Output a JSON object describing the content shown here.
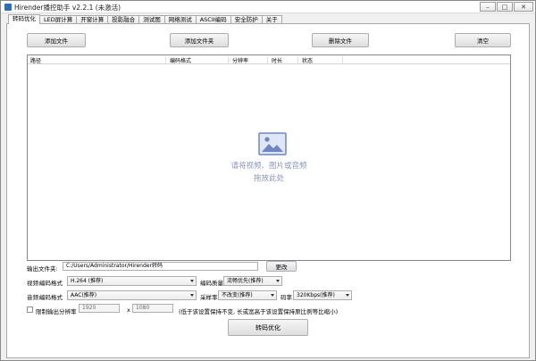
{
  "window": {
    "title": "Hirender播控助手 v2.2.1 (未激活)",
    "minimize_glyph": "–",
    "maximize_glyph": "□",
    "close_glyph": "✕"
  },
  "tabs": [
    {
      "label": "转码优化",
      "active": true
    },
    {
      "label": "LED屏计算"
    },
    {
      "label": "开窗计算"
    },
    {
      "label": "投影融合"
    },
    {
      "label": "测试图"
    },
    {
      "label": "网络测试"
    },
    {
      "label": "ASCII编码"
    },
    {
      "label": "安全防护"
    },
    {
      "label": "关于"
    }
  ],
  "toolbar": {
    "add_file": "添加文件",
    "add_folder": "添加文件夹",
    "delete_file": "删除文件",
    "clear": "清空"
  },
  "file_list": {
    "columns": [
      "路径",
      "编码格式",
      "分辨率",
      "时长",
      "状态"
    ],
    "drop_hint_line1": "请将视频、图片或音频",
    "drop_hint_line2": "拖放此处"
  },
  "output": {
    "label": "输出文件夹:",
    "path": "C:/Users/Administrator/Hirender转码",
    "change_button": "更改"
  },
  "video": {
    "label": "视频:",
    "codec_label": "编码格式",
    "codec_value": "H.264 (推荐)",
    "quality_label": "编码质量",
    "quality_value": "流畅优先(推荐)"
  },
  "audio": {
    "label": "音频:",
    "codec_label": "编码格式",
    "codec_value": "AAC(推荐)",
    "sample_rate_label": "采样率",
    "sample_rate_value": "不改变(推荐)",
    "bitrate_label": "码率",
    "bitrate_value": "320Kbps(推荐)"
  },
  "resolution_limit": {
    "label": "限制输出分辨率",
    "width": "1920",
    "times": "x",
    "height": "1080",
    "note": "(低于该设置保持不变, 长或宽高于该设置保持原比例等比缩小)"
  },
  "transcode_button": "转码优化",
  "colors": {
    "drop_hint": "#8a97b8",
    "icon_accent": "#6f86c4"
  }
}
